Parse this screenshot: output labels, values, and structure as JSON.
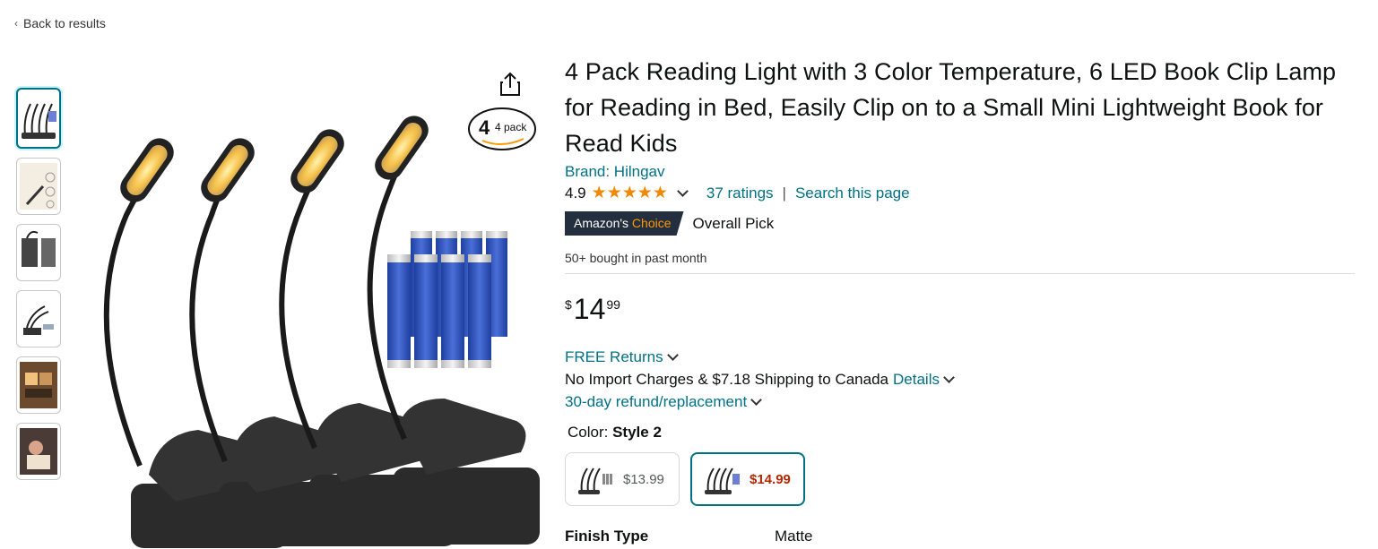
{
  "nav": {
    "back_label": "Back to results"
  },
  "product": {
    "title": "4 Pack Reading Light with 3 Color Temperature, 6 LED Book Clip Lamp for Reading in Bed, Easily Clip on to a Small Mini Lightweight Book for Read Kids",
    "brand": "Brand: Hilngav",
    "rating": "4.9",
    "ratings_count": "37 ratings",
    "search_link": "Search this page",
    "badge_prefix": "Amazon's",
    "badge_choice": "Choice",
    "badge_label": "Overall Pick",
    "bought": "50+ bought in past month",
    "price": {
      "symbol": "$",
      "whole": "14",
      "fraction": "99"
    },
    "free_returns": "FREE Returns",
    "shipping": "No Import Charges & $7.18 Shipping to Canada",
    "details_link": "Details",
    "refund": "30-day refund/replacement",
    "color_label": "Color:",
    "color_value": "Style 2",
    "swatches": [
      {
        "price": "$13.99",
        "selected": false
      },
      {
        "price": "$14.99",
        "selected": true
      }
    ],
    "finish_label": "Finish Type",
    "finish_value": "Matte",
    "image_badge": "4 pack"
  },
  "colors": {
    "link": "#007185",
    "star": "#f08804",
    "badge_bg": "#232f3e",
    "badge_accent": "#ff9900",
    "price_red": "#b12704"
  },
  "icons": [
    "chevron-left-icon",
    "share-icon",
    "star-icon",
    "chevron-down-icon"
  ]
}
